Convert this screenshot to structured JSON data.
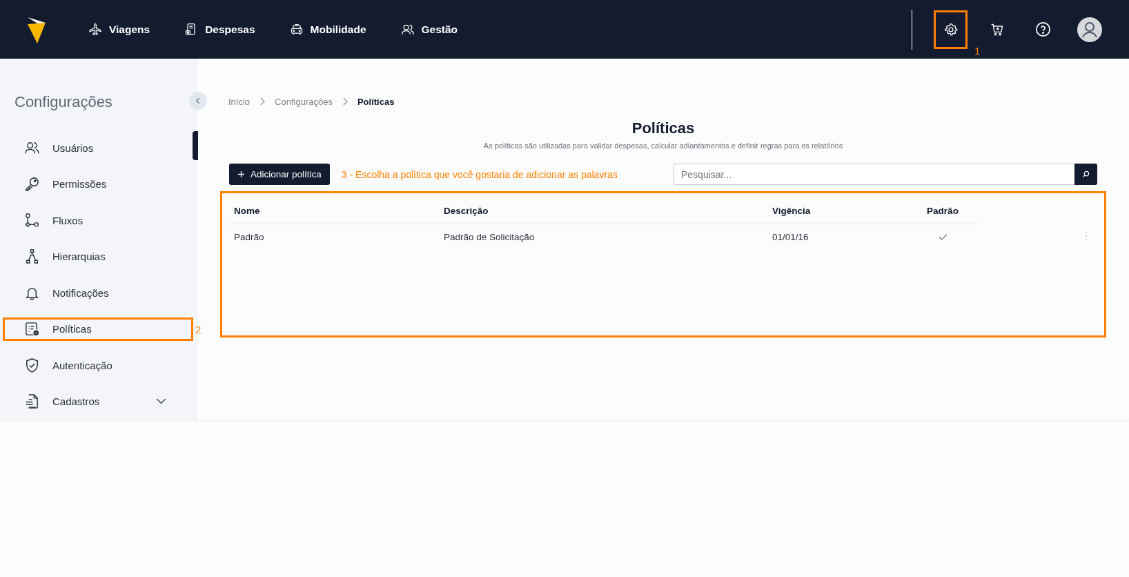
{
  "nav": {
    "items": [
      {
        "label": "Viagens"
      },
      {
        "label": "Despesas"
      },
      {
        "label": "Mobilidade"
      },
      {
        "label": "Gestão"
      }
    ]
  },
  "top_actions": [
    {
      "highlighted": true,
      "callout": "1"
    },
    {
      "highlighted": false
    },
    {
      "highlighted": false
    },
    {
      "highlighted": false
    }
  ],
  "sidebar": {
    "title": "Configurações",
    "items": [
      {
        "label": "Usuários",
        "highlighted": false,
        "expandable": false
      },
      {
        "label": "Permissões",
        "highlighted": false,
        "expandable": false
      },
      {
        "label": "Fluxos",
        "highlighted": false,
        "expandable": false
      },
      {
        "label": "Hierarquias",
        "highlighted": false,
        "expandable": false
      },
      {
        "label": "Notificações",
        "highlighted": false,
        "expandable": false
      },
      {
        "label": "Políticas",
        "highlighted": true,
        "expandable": false,
        "callout": "2"
      },
      {
        "label": "Autenticação",
        "highlighted": false,
        "expandable": false
      },
      {
        "label": "Cadastros",
        "highlighted": false,
        "expandable": true
      }
    ]
  },
  "breadcrumb": [
    {
      "label": "Início",
      "current": false
    },
    {
      "label": "Configurações",
      "current": false
    },
    {
      "label": "Políticas",
      "current": true
    }
  ],
  "page": {
    "title": "Políticas",
    "subtitle": "As políticas são utilizadas para validar despesas, calcular adiantamentos e definir regras para os relatórios"
  },
  "add_button": {
    "label": "Adicionar política"
  },
  "instruction": "3 - Escolha a política que você gostaria de adicionar as palavras",
  "search": {
    "placeholder": "Pesquisar..."
  },
  "table": {
    "highlighted": true,
    "columns": [
      "Nome",
      "Descrição",
      "Vigência",
      "Padrão"
    ],
    "rows": [
      {
        "cells": [
          "Padrão",
          "Padrão de Solicitação",
          "01/01/16"
        ],
        "default": true
      }
    ]
  }
}
